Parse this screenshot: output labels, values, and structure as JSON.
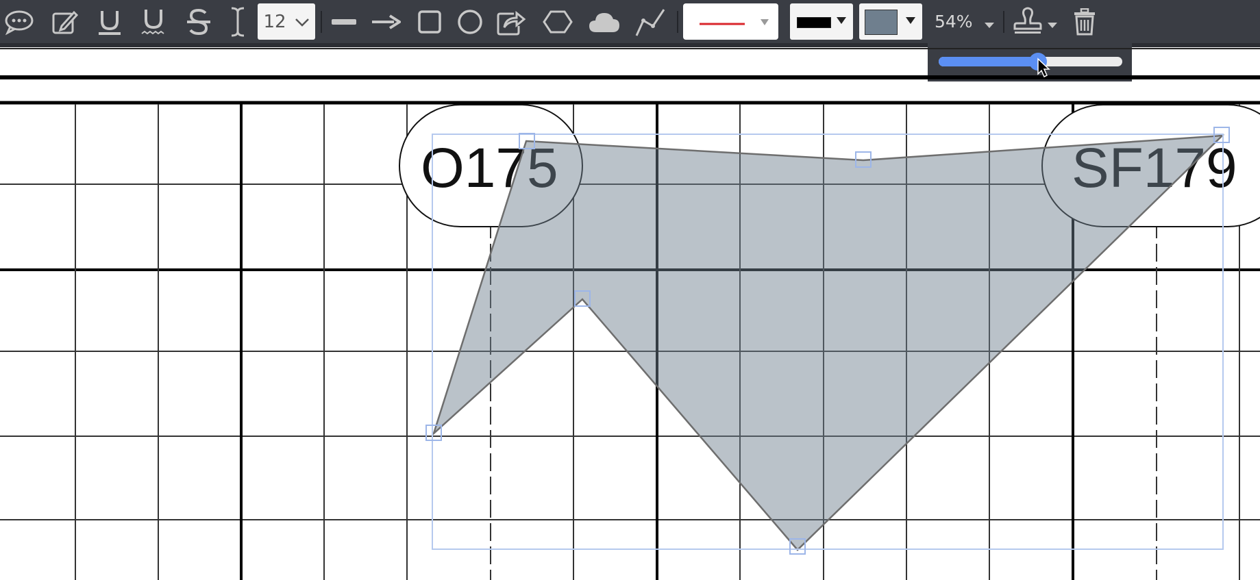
{
  "toolbar": {
    "font_size": "12",
    "opacity_label": "54%",
    "opacity_value": 0.54,
    "line_color": "#d9262b",
    "stroke_color": "#000000",
    "fill_color": "#6f7f8e",
    "tools": [
      "comment-icon",
      "freehand-pencil-icon",
      "underline-icon",
      "squiggly-underline-icon",
      "strikethrough-icon",
      "text-cursor-icon",
      "line-icon",
      "arrow-icon",
      "rectangle-icon",
      "ellipse-icon",
      "callout-share-icon",
      "polygon-icon",
      "cloud-icon",
      "polyline-icon",
      "stamp-icon",
      "trash-icon"
    ]
  },
  "drawing": {
    "labels": [
      "O175",
      "SF179"
    ]
  }
}
